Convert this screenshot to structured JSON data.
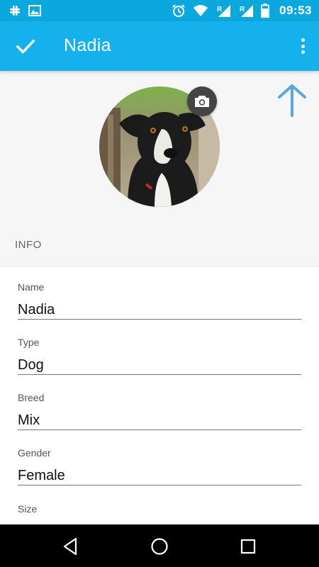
{
  "status_bar": {
    "time": "09:53",
    "icons_left": [
      "slack-icon",
      "image-icon"
    ],
    "icons_right": [
      "alarm-icon",
      "wifi-icon",
      "signal-r-icon",
      "signal-r-icon",
      "battery-icon"
    ],
    "signal_roaming_label": "R"
  },
  "app_bar": {
    "title": "Nadia",
    "left_icon": "check-icon",
    "right_icon": "more-vert-icon"
  },
  "header": {
    "avatar": "dog-photo",
    "camera_icon": "camera-icon",
    "hint_icon": "arrow-up-icon",
    "section_label": "INFO"
  },
  "form": {
    "fields": [
      {
        "label": "Name",
        "value": "Nadia"
      },
      {
        "label": "Type",
        "value": "Dog"
      },
      {
        "label": "Breed",
        "value": "Mix"
      },
      {
        "label": "Gender",
        "value": "Female"
      },
      {
        "label": "Size",
        "value": ""
      }
    ]
  },
  "nav_bar": {
    "buttons": [
      "back-icon",
      "home-icon",
      "recents-icon"
    ]
  },
  "colors": {
    "status_bar": "#0aa8df",
    "app_bar": "#15b1ec",
    "hint_arrow": "#5aa6dc"
  }
}
